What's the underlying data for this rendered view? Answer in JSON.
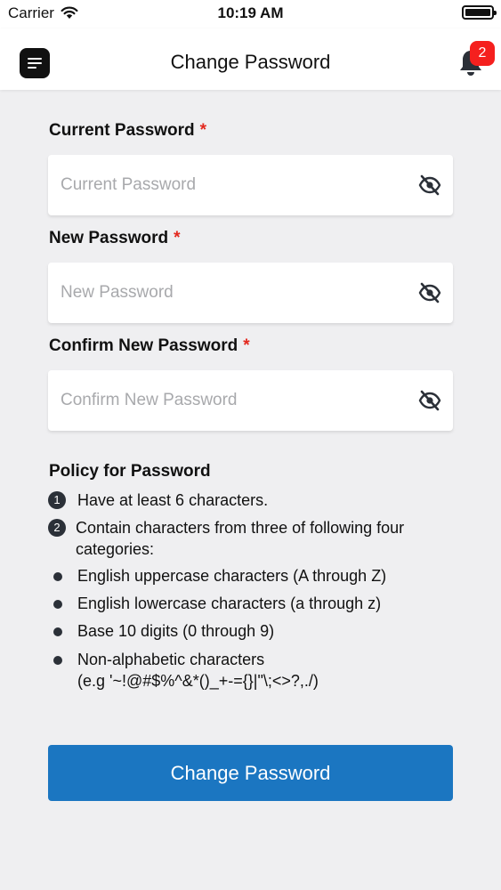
{
  "status_bar": {
    "carrier": "Carrier",
    "time": "10:19 AM"
  },
  "nav": {
    "title": "Change Password",
    "notification_count": "2",
    "menu_icon": "menu-icon",
    "bell_icon": "bell-icon"
  },
  "form": {
    "required_mark": "*",
    "current": {
      "label": "Current Password",
      "placeholder": "Current Password",
      "value": ""
    },
    "new": {
      "label": "New Password",
      "placeholder": "New Password",
      "value": ""
    },
    "confirm": {
      "label": "Confirm New Password",
      "placeholder": "Confirm New Password",
      "value": ""
    },
    "toggle_icon": "eye-slash-icon"
  },
  "policy": {
    "title": "Policy for Password",
    "rules": [
      {
        "marker": "1",
        "text": "Have at least 6 characters."
      },
      {
        "marker": "2",
        "text": "Contain characters from three of following four categories:"
      }
    ],
    "categories": [
      "English uppercase characters (A through Z)",
      "English lowercase characters (a through z)",
      "Base 10 digits (0 through 9)",
      "Non-alphabetic characters"
    ],
    "example": "(e.g '~!@#$%^&*()_+-={}|\"\\;<>?,./)"
  },
  "submit_label": "Change Password",
  "colors": {
    "primary": "#1b76c1",
    "required": "#e3281e",
    "badge": "#f5201e",
    "background": "#efeff1"
  }
}
